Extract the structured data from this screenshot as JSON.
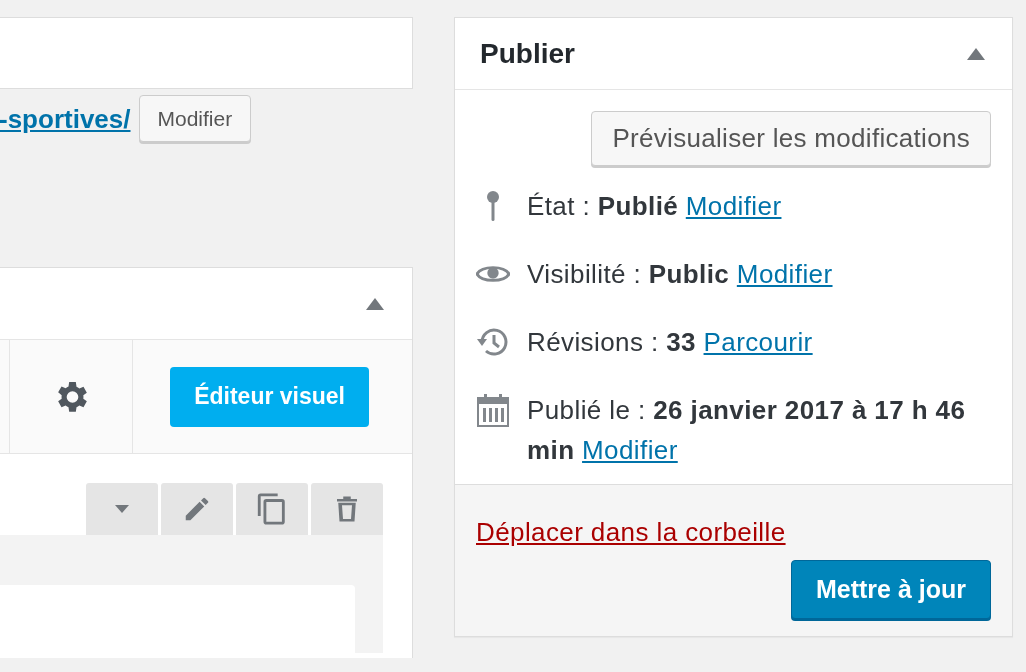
{
  "permalink": {
    "link": "-sportives/",
    "button": "Modifier"
  },
  "editor": {
    "mode_button": "Éditeur visuel"
  },
  "publish": {
    "title": "Publier",
    "preview_button": "Prévisualiser les modifications",
    "rows": [
      {
        "kind": "status",
        "text": "État : **Publié**",
        "link": "Modifier"
      },
      {
        "kind": "visibility",
        "text": "Visibilité : **Public**",
        "link": "Modifier"
      },
      {
        "kind": "revisions",
        "text": "Révisions : **33**",
        "link": "Parcourir"
      },
      {
        "kind": "date",
        "text": "Publié le : **26 janvier 2017 à 17 h 46 min**",
        "link": "Modifier"
      }
    ],
    "trash_link": "Déplacer dans la corbeille",
    "update_button": "Mettre à jour"
  }
}
